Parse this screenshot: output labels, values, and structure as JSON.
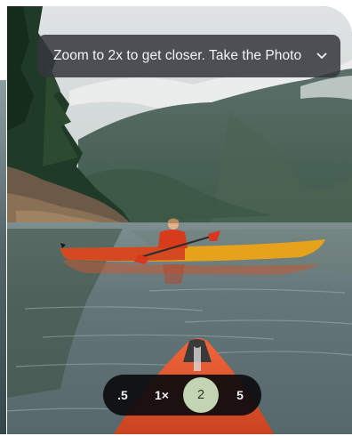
{
  "tip_banner": {
    "text": "Zoom to 2x to get closer. Take the Photo",
    "chevron_icon": "chevron-down-icon"
  },
  "zoom_levels": [
    {
      "label": ".5",
      "selected": false
    },
    {
      "label": "1×",
      "selected": false
    },
    {
      "label": "2",
      "selected": true
    },
    {
      "label": "5",
      "selected": false
    }
  ],
  "colors": {
    "zoom_selected": "#c3d4b2",
    "zoom_bar": "#0c0c0e",
    "banner": "#34373c"
  }
}
